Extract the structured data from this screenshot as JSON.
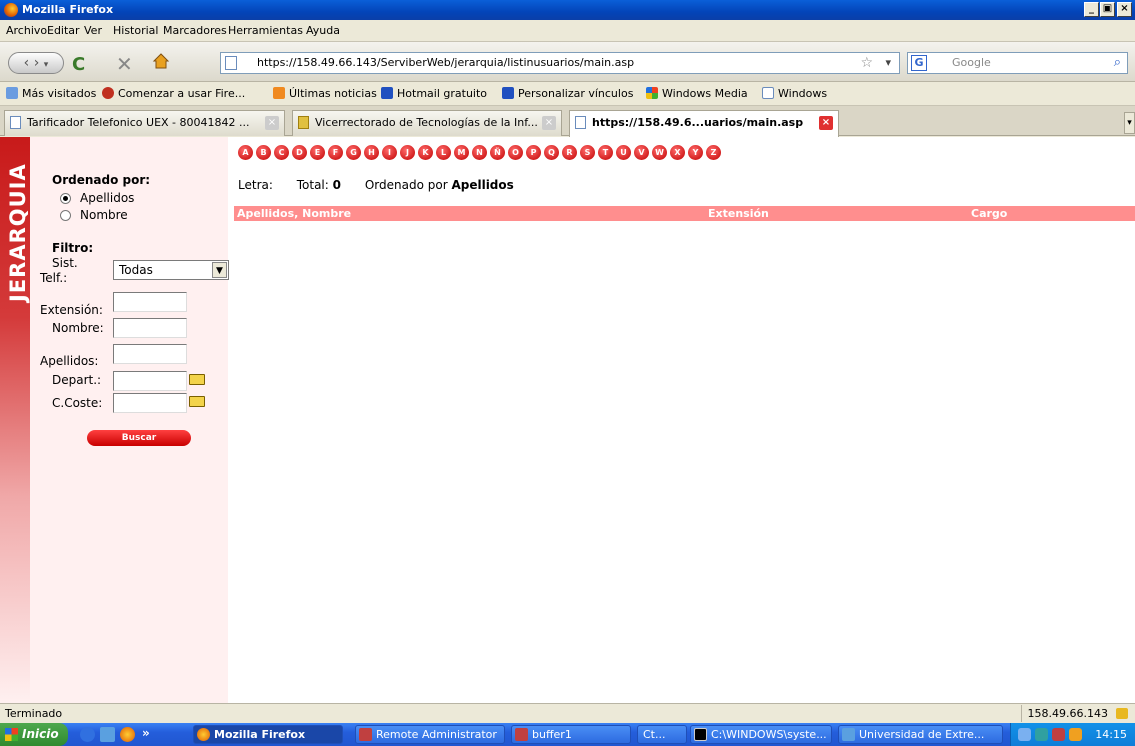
{
  "window": {
    "title": "Mozilla Firefox",
    "min_label": "_",
    "max_label": " ",
    "close_label": "×"
  },
  "menu": [
    "Archivo",
    "Editar",
    "Ver",
    "Historial",
    "Marcadores",
    "Herramientas",
    "Ayuda"
  ],
  "nav": {
    "url": "https://158.49.66.143/ServiberWeb/jerarquia/listinusuarios/main.asp",
    "search_placeholder": "Google",
    "star": "☆",
    "dropdown": "▾"
  },
  "bookmarks": [
    "Más visitados",
    "Comenzar a usar Fire...",
    "Últimas noticias",
    "Hotmail gratuito",
    "Personalizar vínculos",
    "Windows Media",
    "Windows"
  ],
  "tabs": [
    {
      "label": "Tarificador Telefonico UEX - 80041842 ...",
      "active": false
    },
    {
      "label": "Vicerrectorado de Tecnologías de la Inf...",
      "active": false
    },
    {
      "label": "https://158.49.6...uarios/main.asp",
      "active": true
    }
  ],
  "sidebar": {
    "vertical_title": "JERARQUIA",
    "order_heading": "Ordenado por:",
    "order_options": [
      "Apellidos",
      "Nombre"
    ],
    "order_selected": "Apellidos",
    "filter_heading": "Filtro:",
    "sist_label_1": "Sist.",
    "sist_label_2": "Telf.:",
    "sist_value": "Todas",
    "extension_label": "Extensión:",
    "nombre_label": "Nombre:",
    "apellidos_label": "Apellidos:",
    "depart_label": "Depart.:",
    "ccoste_label": "C.Coste:",
    "search_button": "Buscar"
  },
  "letters": [
    "A",
    "B",
    "C",
    "D",
    "E",
    "F",
    "G",
    "H",
    "I",
    "J",
    "K",
    "L",
    "M",
    "N",
    "Ñ",
    "O",
    "P",
    "Q",
    "R",
    "S",
    "T",
    "U",
    "V",
    "W",
    "X",
    "Y",
    "Z"
  ],
  "info": {
    "letra_label": "Letra:",
    "total_label": "Total:",
    "total_value": "0",
    "order_prefix": "Ordenado por",
    "order_value": "Apellidos"
  },
  "table": {
    "headers": [
      "Apellidos, Nombre",
      "Extensión",
      "Cargo"
    ]
  },
  "status": {
    "text": "Terminado",
    "host": "158.49.66.143"
  },
  "taskbar": {
    "start": "Inicio",
    "more": "»",
    "items": [
      {
        "label": "Mozilla Firefox",
        "active": true
      },
      {
        "label": "Remote Administrator",
        "active": false
      },
      {
        "label": "buffer1",
        "active": false
      },
      {
        "label": "Ct...",
        "active": false
      },
      {
        "label": "C:\\WINDOWS\\syste...",
        "active": false
      },
      {
        "label": "Universidad de Extre...",
        "active": false
      }
    ],
    "clock": "14:15"
  },
  "colors": {
    "accent_red": "#ff8e8e",
    "sidebar_bg": "#fff0f0",
    "letter_red": "#c00000"
  }
}
